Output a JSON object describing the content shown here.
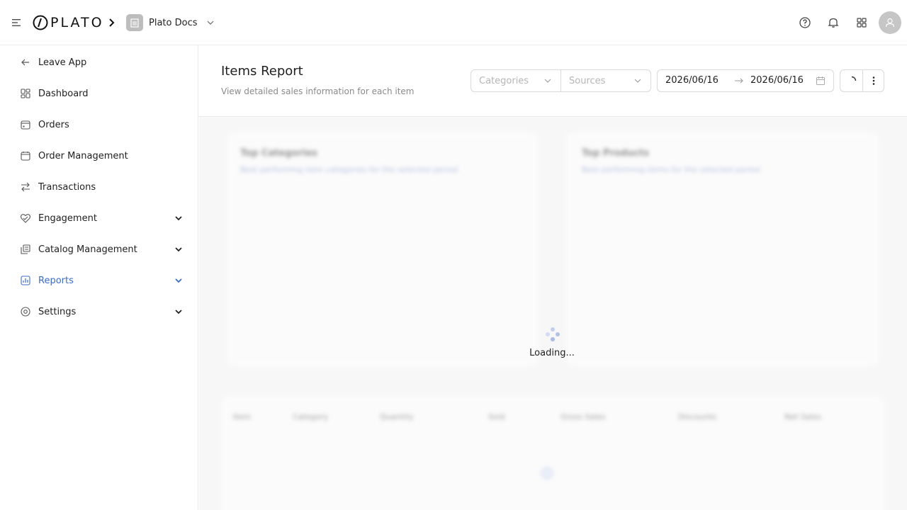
{
  "app": {
    "brand": "PLATO",
    "workspace": "Plato Docs"
  },
  "sidebar": {
    "items": [
      {
        "label": "Leave App",
        "icon": "arrow-left-icon"
      },
      {
        "label": "Dashboard",
        "icon": "dashboard-icon"
      },
      {
        "label": "Orders",
        "icon": "orders-icon"
      },
      {
        "label": "Order Management",
        "icon": "order-management-icon"
      },
      {
        "label": "Transactions",
        "icon": "transactions-icon"
      },
      {
        "label": "Engagement",
        "icon": "engagement-icon",
        "expandable": true
      },
      {
        "label": "Catalog Management",
        "icon": "catalog-icon",
        "expandable": true
      },
      {
        "label": "Reports",
        "icon": "reports-icon",
        "expandable": true,
        "active": true
      },
      {
        "label": "Settings",
        "icon": "settings-icon",
        "expandable": true
      }
    ],
    "active_color": "#3b6cc4"
  },
  "header": {
    "title": "Items Report",
    "subtitle": "View detailed sales information for each item",
    "filters": {
      "categories_placeholder": "Categories",
      "sources_placeholder": "Sources"
    },
    "date_range": {
      "start": "2026/06/16",
      "end": "2026/06/16"
    }
  },
  "content": {
    "loading_text": "Loading...",
    "placeholder_cards": [
      {
        "title": "Top Categories",
        "subtitle": "Best performing item categories for the selected period"
      },
      {
        "title": "Top Products",
        "subtitle": "Best performing items for the selected period"
      }
    ],
    "table_headers": [
      "Item",
      "Category",
      "Quantity",
      "Sold",
      "Gross Sales",
      "Discounts",
      "Net Sales"
    ]
  }
}
